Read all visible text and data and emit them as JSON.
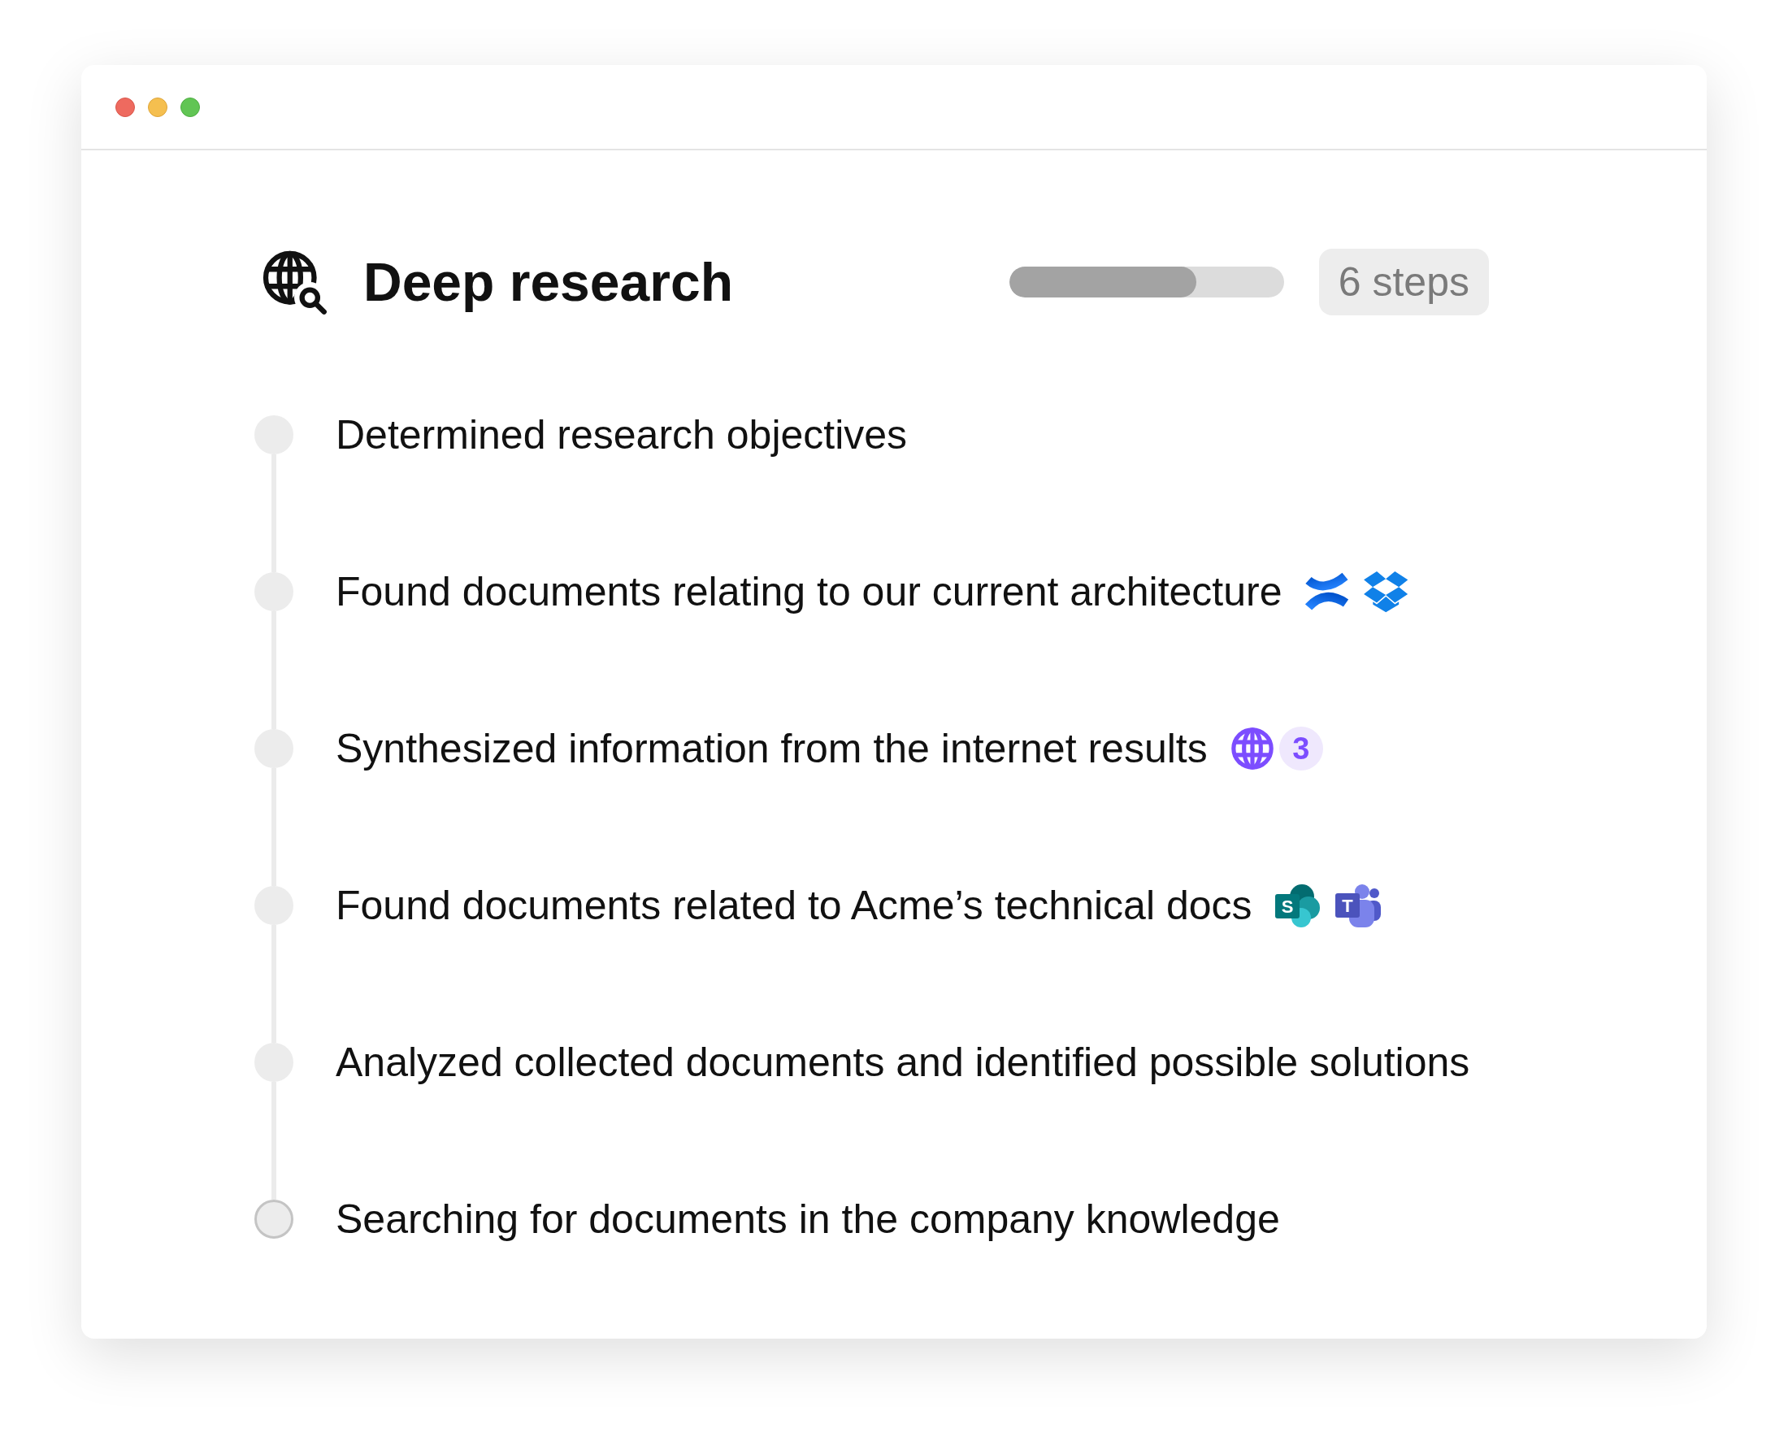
{
  "header": {
    "title": "Deep research",
    "progress": {
      "level": 0.68
    },
    "steps_badge": "6 steps"
  },
  "steps": [
    {
      "label": "Determined research objectives",
      "completed": true
    },
    {
      "label": "Found documents relating to our current architecture",
      "completed": true,
      "sources": [
        {
          "kind": "confluence"
        },
        {
          "kind": "dropbox"
        }
      ]
    },
    {
      "label": "Synthesized information from the internet results",
      "completed": true,
      "sources": [
        {
          "kind": "web",
          "count": "3"
        }
      ]
    },
    {
      "label": "Found documents related to Acme’s technical docs",
      "completed": true,
      "sources": [
        {
          "kind": "sharepoint",
          "letter": "S"
        },
        {
          "kind": "teams",
          "letter": "T"
        }
      ]
    },
    {
      "label": "Analyzed collected documents and identified possible solutions",
      "completed": true
    },
    {
      "label": "Searching for documents in the company knowledge",
      "completed": false
    }
  ]
}
